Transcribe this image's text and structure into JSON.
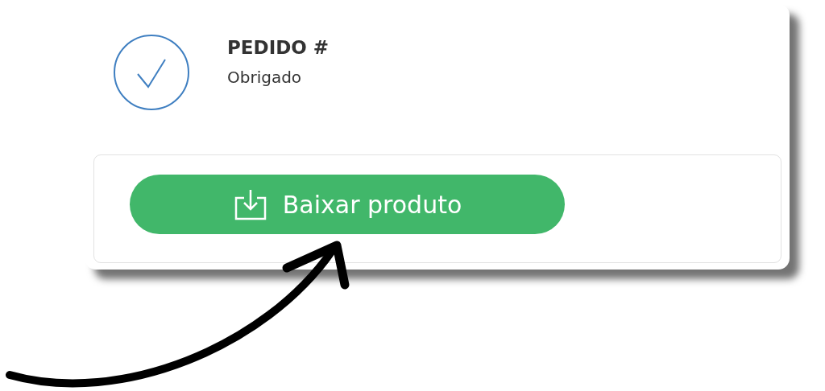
{
  "order": {
    "title": "PEDIDO #",
    "subtitle": "Obrigado"
  },
  "download_button": {
    "label": "Baixar produto"
  }
}
